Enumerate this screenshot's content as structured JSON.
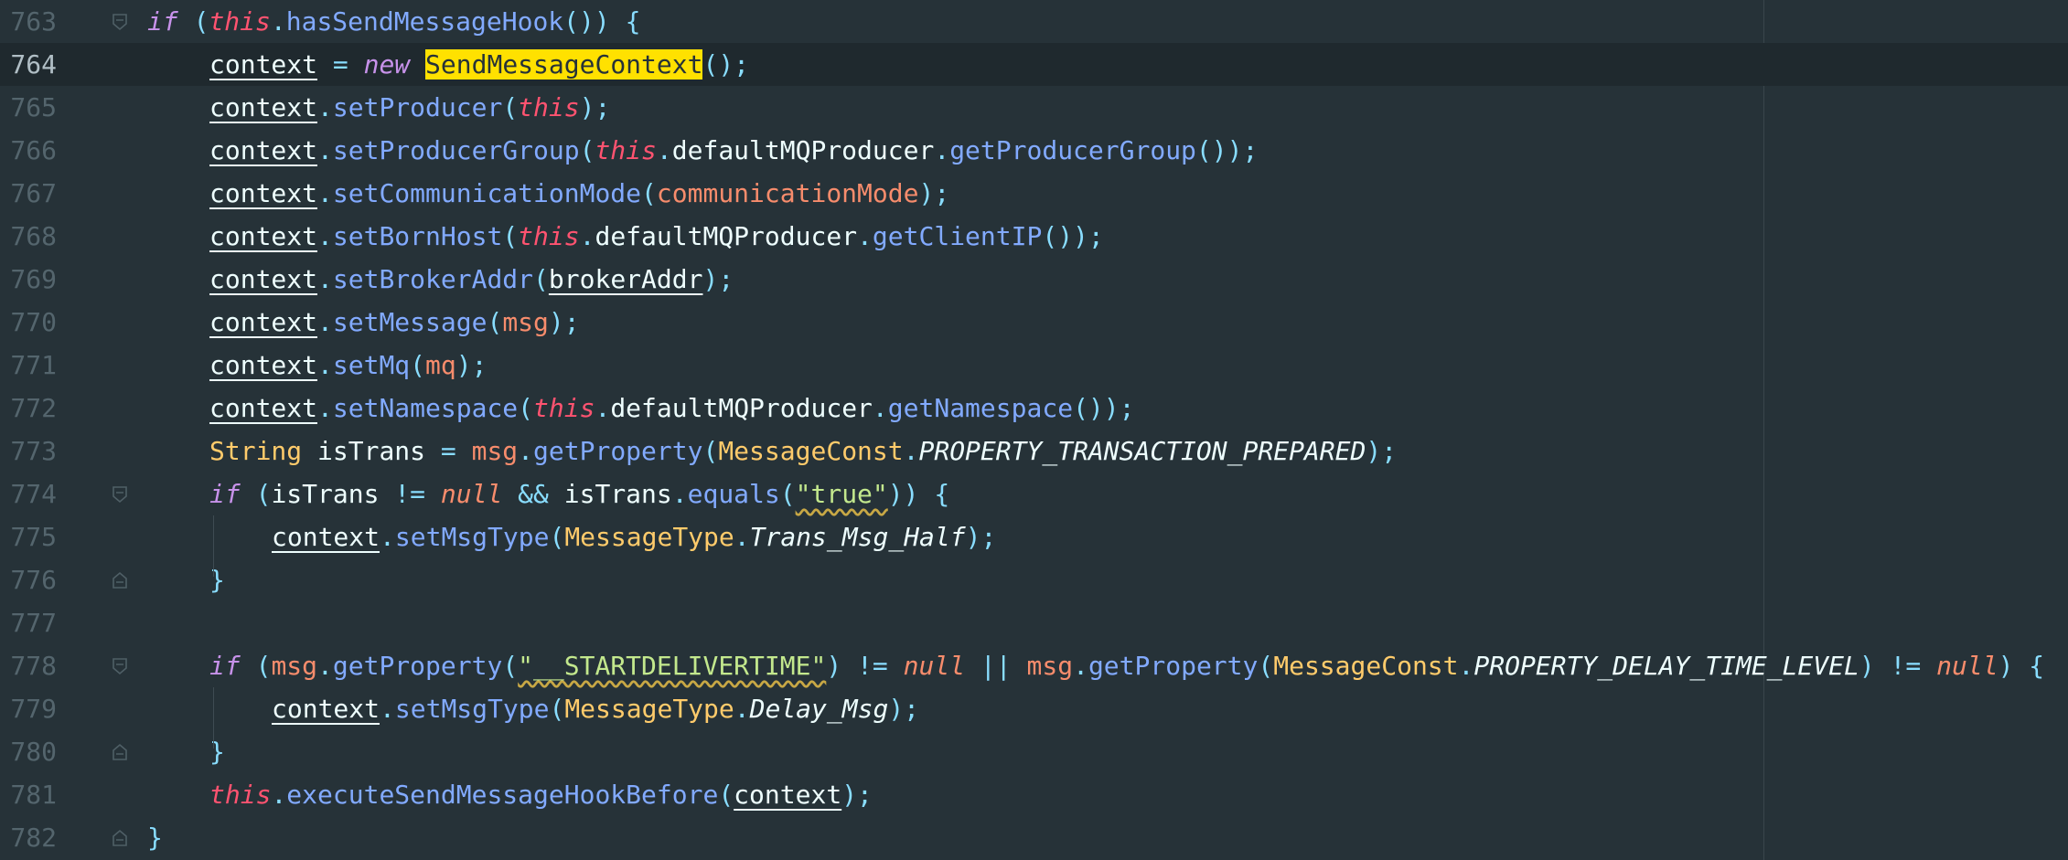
{
  "editor": {
    "current_line": 764,
    "colors": {
      "background": "#263238",
      "keyword": "#c792ea",
      "this": "#ff5370",
      "method": "#82aaff",
      "punctuation": "#89ddff",
      "string": "#c3e88d",
      "class": "#ffcb6b",
      "parameter": "#f78c6c",
      "search_highlight": "#ffe100"
    },
    "lines": [
      {
        "number": "763",
        "fold": "start",
        "indent": 0,
        "tokens": [
          [
            "kw",
            "if"
          ],
          [
            "plain",
            " "
          ],
          [
            "pun",
            "("
          ],
          [
            "this",
            "this"
          ],
          [
            "pun",
            "."
          ],
          [
            "fn",
            "hasSendMessageHook"
          ],
          [
            "pun",
            "())"
          ],
          [
            "plain",
            " "
          ],
          [
            "pun",
            "{"
          ]
        ]
      },
      {
        "number": "764",
        "fold": "",
        "indent": 1,
        "tokens": [
          [
            "var",
            "context"
          ],
          [
            "plain",
            " "
          ],
          [
            "pun",
            "="
          ],
          [
            "plain",
            " "
          ],
          [
            "kw",
            "new"
          ],
          [
            "plain",
            " "
          ],
          [
            "hl",
            "SendMessageContext"
          ],
          [
            "pun",
            "();"
          ]
        ]
      },
      {
        "number": "765",
        "fold": "",
        "indent": 1,
        "tokens": [
          [
            "var",
            "context"
          ],
          [
            "pun",
            "."
          ],
          [
            "fn",
            "setProducer"
          ],
          [
            "pun",
            "("
          ],
          [
            "this",
            "this"
          ],
          [
            "pun",
            ");"
          ]
        ]
      },
      {
        "number": "766",
        "fold": "",
        "indent": 1,
        "tokens": [
          [
            "var",
            "context"
          ],
          [
            "pun",
            "."
          ],
          [
            "fn",
            "setProducerGroup"
          ],
          [
            "pun",
            "("
          ],
          [
            "this",
            "this"
          ],
          [
            "pun",
            "."
          ],
          [
            "plain",
            "defaultMQProducer"
          ],
          [
            "pun",
            "."
          ],
          [
            "fn",
            "getProducerGroup"
          ],
          [
            "pun",
            "());"
          ]
        ]
      },
      {
        "number": "767",
        "fold": "",
        "indent": 1,
        "tokens": [
          [
            "var",
            "context"
          ],
          [
            "pun",
            "."
          ],
          [
            "fn",
            "setCommunicationMode"
          ],
          [
            "pun",
            "("
          ],
          [
            "param",
            "communicationMode"
          ],
          [
            "pun",
            ");"
          ]
        ]
      },
      {
        "number": "768",
        "fold": "",
        "indent": 1,
        "tokens": [
          [
            "var",
            "context"
          ],
          [
            "pun",
            "."
          ],
          [
            "fn",
            "setBornHost"
          ],
          [
            "pun",
            "("
          ],
          [
            "this",
            "this"
          ],
          [
            "pun",
            "."
          ],
          [
            "plain",
            "defaultMQProducer"
          ],
          [
            "pun",
            "."
          ],
          [
            "fn",
            "getClientIP"
          ],
          [
            "pun",
            "());"
          ]
        ]
      },
      {
        "number": "769",
        "fold": "",
        "indent": 1,
        "tokens": [
          [
            "var",
            "context"
          ],
          [
            "pun",
            "."
          ],
          [
            "fn",
            "setBrokerAddr"
          ],
          [
            "pun",
            "("
          ],
          [
            "var",
            "brokerAddr"
          ],
          [
            "pun",
            ");"
          ]
        ]
      },
      {
        "number": "770",
        "fold": "",
        "indent": 1,
        "tokens": [
          [
            "var",
            "context"
          ],
          [
            "pun",
            "."
          ],
          [
            "fn",
            "setMessage"
          ],
          [
            "pun",
            "("
          ],
          [
            "param",
            "msg"
          ],
          [
            "pun",
            ");"
          ]
        ]
      },
      {
        "number": "771",
        "fold": "",
        "indent": 1,
        "tokens": [
          [
            "var",
            "context"
          ],
          [
            "pun",
            "."
          ],
          [
            "fn",
            "setMq"
          ],
          [
            "pun",
            "("
          ],
          [
            "param",
            "mq"
          ],
          [
            "pun",
            ");"
          ]
        ]
      },
      {
        "number": "772",
        "fold": "",
        "indent": 1,
        "tokens": [
          [
            "var",
            "context"
          ],
          [
            "pun",
            "."
          ],
          [
            "fn",
            "setNamespace"
          ],
          [
            "pun",
            "("
          ],
          [
            "this",
            "this"
          ],
          [
            "pun",
            "."
          ],
          [
            "plain",
            "defaultMQProducer"
          ],
          [
            "pun",
            "."
          ],
          [
            "fn",
            "getNamespace"
          ],
          [
            "pun",
            "());"
          ]
        ]
      },
      {
        "number": "773",
        "fold": "",
        "indent": 1,
        "tokens": [
          [
            "cls",
            "String"
          ],
          [
            "plain",
            " isTrans "
          ],
          [
            "pun",
            "="
          ],
          [
            "plain",
            " "
          ],
          [
            "param",
            "msg"
          ],
          [
            "pun",
            "."
          ],
          [
            "fn",
            "getProperty"
          ],
          [
            "pun",
            "("
          ],
          [
            "cls",
            "MessageConst"
          ],
          [
            "pun",
            "."
          ],
          [
            "con",
            "PROPERTY_TRANSACTION_PREPARED"
          ],
          [
            "pun",
            ");"
          ]
        ]
      },
      {
        "number": "774",
        "fold": "start",
        "indent": 1,
        "tokens": [
          [
            "kw",
            "if"
          ],
          [
            "plain",
            " "
          ],
          [
            "pun",
            "("
          ],
          [
            "plain",
            "isTrans "
          ],
          [
            "pun",
            "!="
          ],
          [
            "plain",
            " "
          ],
          [
            "nul",
            "null"
          ],
          [
            "plain",
            " "
          ],
          [
            "pun",
            "&&"
          ],
          [
            "plain",
            " isTrans"
          ],
          [
            "pun",
            "."
          ],
          [
            "fn",
            "equals"
          ],
          [
            "pun",
            "("
          ],
          [
            "str wavy",
            "\"true\""
          ],
          [
            "pun",
            "))"
          ],
          [
            "plain",
            " "
          ],
          [
            "pun",
            "{"
          ]
        ]
      },
      {
        "number": "775",
        "fold": "",
        "indent": 2,
        "tokens": [
          [
            "var",
            "context"
          ],
          [
            "pun",
            "."
          ],
          [
            "fn",
            "setMsgType"
          ],
          [
            "pun",
            "("
          ],
          [
            "cls",
            "MessageType"
          ],
          [
            "pun",
            "."
          ],
          [
            "con",
            "Trans_Msg_Half"
          ],
          [
            "pun",
            ");"
          ]
        ]
      },
      {
        "number": "776",
        "fold": "end",
        "indent": 1,
        "tokens": [
          [
            "pun",
            "}"
          ]
        ]
      },
      {
        "number": "777",
        "fold": "",
        "indent": 0,
        "tokens": []
      },
      {
        "number": "778",
        "fold": "start",
        "indent": 1,
        "tokens": [
          [
            "kw",
            "if"
          ],
          [
            "plain",
            " "
          ],
          [
            "pun",
            "("
          ],
          [
            "param",
            "msg"
          ],
          [
            "pun",
            "."
          ],
          [
            "fn",
            "getProperty"
          ],
          [
            "pun",
            "("
          ],
          [
            "str wavy",
            "\"__STARTDELIVERTIME\""
          ],
          [
            "pun",
            ")"
          ],
          [
            "plain",
            " "
          ],
          [
            "pun",
            "!="
          ],
          [
            "plain",
            " "
          ],
          [
            "nul",
            "null"
          ],
          [
            "plain",
            " "
          ],
          [
            "pun",
            "||"
          ],
          [
            "plain",
            " "
          ],
          [
            "param",
            "msg"
          ],
          [
            "pun",
            "."
          ],
          [
            "fn",
            "getProperty"
          ],
          [
            "pun",
            "("
          ],
          [
            "cls",
            "MessageConst"
          ],
          [
            "pun",
            "."
          ],
          [
            "con",
            "PROPERTY_DELAY_TIME_LEVEL"
          ],
          [
            "pun",
            ")"
          ],
          [
            "plain",
            " "
          ],
          [
            "pun",
            "!="
          ],
          [
            "plain",
            " "
          ],
          [
            "nul",
            "null"
          ],
          [
            "pun",
            ")"
          ],
          [
            "plain",
            " "
          ],
          [
            "pun",
            "{"
          ]
        ]
      },
      {
        "number": "779",
        "fold": "",
        "indent": 2,
        "tokens": [
          [
            "var",
            "context"
          ],
          [
            "pun",
            "."
          ],
          [
            "fn",
            "setMsgType"
          ],
          [
            "pun",
            "("
          ],
          [
            "cls",
            "MessageType"
          ],
          [
            "pun",
            "."
          ],
          [
            "con",
            "Delay_Msg"
          ],
          [
            "pun",
            ");"
          ]
        ]
      },
      {
        "number": "780",
        "fold": "end",
        "indent": 1,
        "tokens": [
          [
            "pun",
            "}"
          ]
        ]
      },
      {
        "number": "781",
        "fold": "",
        "indent": 1,
        "tokens": [
          [
            "this",
            "this"
          ],
          [
            "pun",
            "."
          ],
          [
            "fn",
            "executeSendMessageHookBefore"
          ],
          [
            "pun",
            "("
          ],
          [
            "var",
            "context"
          ],
          [
            "pun",
            ");"
          ]
        ]
      },
      {
        "number": "782",
        "fold": "end",
        "indent": 0,
        "tokens": [
          [
            "pun",
            "}"
          ]
        ]
      }
    ]
  }
}
